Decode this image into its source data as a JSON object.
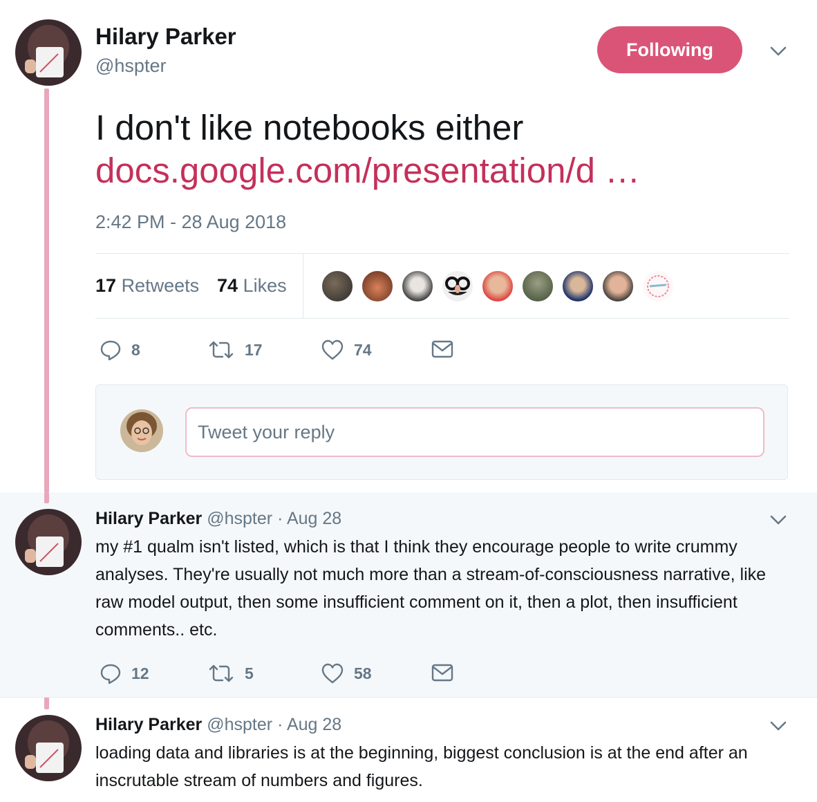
{
  "main_tweet": {
    "author_name": "Hilary Parker",
    "author_handle": "@hspter",
    "follow_label": "Following",
    "text": "I don't like notebooks either",
    "link": "docs.google.com/presentation/d …",
    "timestamp": "2:42 PM - 28 Aug 2018",
    "retweets_count": "17",
    "retweets_label": "Retweets",
    "likes_count": "74",
    "likes_label": "Likes",
    "actions": {
      "replies": "8",
      "retweets": "17",
      "likes": "74"
    }
  },
  "reply_composer": {
    "placeholder": "Tweet your reply"
  },
  "replies": [
    {
      "author_name": "Hilary Parker",
      "author_handle": "@hspter",
      "separator": "·",
      "date": "Aug 28",
      "text": "my #1 qualm isn't listed, which is that I think they encourage people to write crummy analyses. They're usually not much more than a stream-of-consciousness narrative, like raw model output, then some insufficient comment on it, then a plot, then insufficient comments.. etc.",
      "actions": {
        "replies": "12",
        "retweets": "5",
        "likes": "58"
      }
    },
    {
      "author_name": "Hilary Parker",
      "author_handle": "@hspter",
      "separator": "·",
      "date": "Aug 28",
      "text": "loading data and libraries is at the beginning, biggest conclusion is at the end after an inscrutable stream of numbers and figures."
    }
  ],
  "colors": {
    "accent": "#da5478",
    "link": "#c4305a",
    "thread_line": "#e9a7bb",
    "muted": "#657786"
  }
}
